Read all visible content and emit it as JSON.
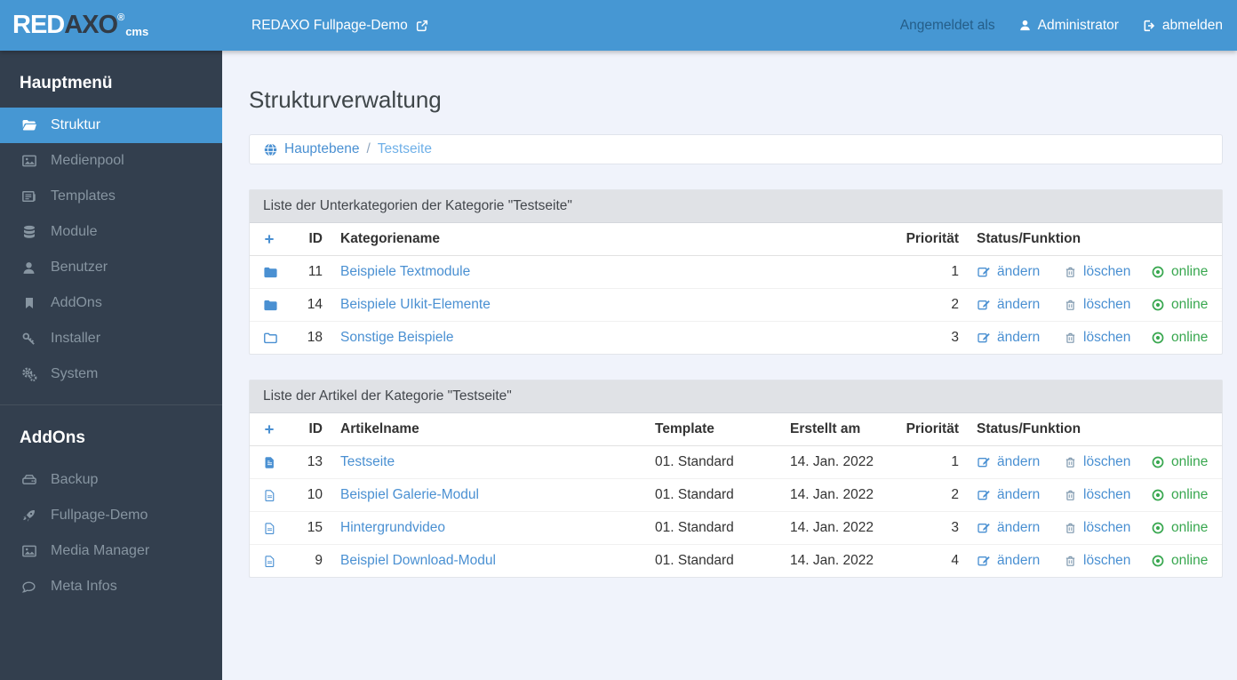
{
  "topbar": {
    "logo": {
      "red": "RED",
      "axo": "AXO",
      "reg": "®",
      "cms": "cms"
    },
    "site_link": "REDAXO Fullpage-Demo",
    "logged_in_as": "Angemeldet als",
    "user": "Administrator",
    "logout": "abmelden"
  },
  "sidebar": {
    "main_title": "Hauptmenü",
    "main_items": [
      {
        "label": "Struktur",
        "icon": "folder-open-icon",
        "active": true
      },
      {
        "label": "Medienpool",
        "icon": "image-icon",
        "active": false
      },
      {
        "label": "Templates",
        "icon": "newspaper-icon",
        "active": false
      },
      {
        "label": "Module",
        "icon": "database-icon",
        "active": false
      },
      {
        "label": "Benutzer",
        "icon": "user-icon",
        "active": false
      },
      {
        "label": "AddOns",
        "icon": "bookmark-icon",
        "active": false
      },
      {
        "label": "Installer",
        "icon": "key-icon",
        "active": false
      },
      {
        "label": "System",
        "icon": "cogs-icon",
        "active": false
      }
    ],
    "addons_title": "AddOns",
    "addon_items": [
      {
        "label": "Backup",
        "icon": "hdd-icon"
      },
      {
        "label": "Fullpage-Demo",
        "icon": "rocket-icon"
      },
      {
        "label": "Media Manager",
        "icon": "image-icon"
      },
      {
        "label": "Meta Infos",
        "icon": "comment-icon"
      }
    ]
  },
  "main": {
    "page_title": "Strukturverwaltung",
    "breadcrumb": {
      "root": "Hauptebene",
      "separator": "/",
      "current": "Testseite"
    },
    "actions": {
      "edit": "ändern",
      "delete": "löschen",
      "online": "online"
    },
    "categories_panel": {
      "title": "Liste der Unterkategorien der Kategorie \"Testseite\"",
      "headers": {
        "id": "ID",
        "name": "Kategoriename",
        "priority": "Priorität",
        "status": "Status/Funktion"
      },
      "rows": [
        {
          "icon": "folder-solid-icon",
          "id": "11",
          "name": "Beispiele Textmodule",
          "priority": "1"
        },
        {
          "icon": "folder-solid-icon",
          "id": "14",
          "name": "Beispiele UIkit-Elemente",
          "priority": "2"
        },
        {
          "icon": "folder-outline-icon",
          "id": "18",
          "name": "Sonstige Beispiele",
          "priority": "3"
        }
      ]
    },
    "articles_panel": {
      "title": "Liste der Artikel der Kategorie \"Testseite\"",
      "headers": {
        "id": "ID",
        "name": "Artikelname",
        "template": "Template",
        "created": "Erstellt am",
        "priority": "Priorität",
        "status": "Status/Funktion"
      },
      "rows": [
        {
          "icon": "file-solid-icon",
          "id": "13",
          "name": "Testseite",
          "template": "01. Standard",
          "created": "14. Jan. 2022",
          "priority": "1"
        },
        {
          "icon": "file-outline-icon",
          "id": "10",
          "name": "Beispiel Galerie-Modul",
          "template": "01. Standard",
          "created": "14. Jan. 2022",
          "priority": "2"
        },
        {
          "icon": "file-outline-icon",
          "id": "15",
          "name": "Hintergrundvideo",
          "template": "01. Standard",
          "created": "14. Jan. 2022",
          "priority": "3"
        },
        {
          "icon": "file-outline-icon",
          "id": "9",
          "name": "Beispiel Download-Modul",
          "template": "01. Standard",
          "created": "14. Jan. 2022",
          "priority": "4"
        }
      ]
    }
  },
  "colors": {
    "topbar_blue": "#4697d3",
    "sidebar_bg": "#333f4e",
    "sidebar_text": "#8795a1",
    "link_blue": "#4a90d2",
    "link_light_blue": "#6fb0e8",
    "online_green": "#38a74f",
    "panel_heading_bg": "#e0e2e6",
    "page_bg": "#f0f3fb",
    "logo_dark": "#323b46"
  }
}
